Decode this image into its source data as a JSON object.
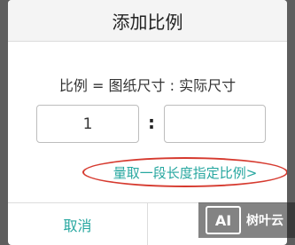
{
  "dialog": {
    "title": "添加比例",
    "ratio_label": "比例 = 图纸尺寸 : 实际尺寸",
    "drawing_value": "1",
    "actual_value": "",
    "colon": ":",
    "measure_link": "量取一段长度指定比例>",
    "cancel_label": "取消",
    "confirm_label": ""
  },
  "watermark": {
    "logo": "AI",
    "text": "树叶云"
  },
  "colors": {
    "accent": "#27a7a0",
    "highlight_circle": "#d63a2f"
  }
}
